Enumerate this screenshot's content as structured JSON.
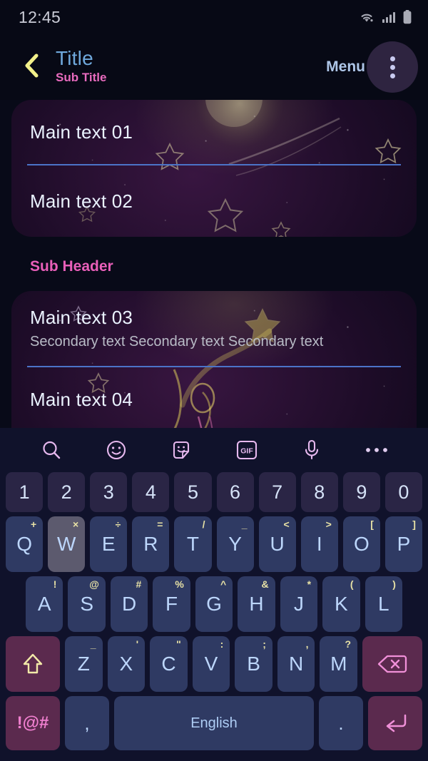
{
  "status_bar": {
    "time": "12:45",
    "icons": [
      "wifi-icon",
      "signal-icon",
      "battery-icon"
    ]
  },
  "app_bar": {
    "back_icon": "chevron-left-icon",
    "title": "Title",
    "subtitle": "Sub Title",
    "menu_label": "Menu",
    "overflow_icon": "more-vertical-icon"
  },
  "content": {
    "card_one": {
      "rows": [
        {
          "main": "Main text 01"
        },
        {
          "main": "Main text 02"
        }
      ]
    },
    "sub_header": "Sub Header",
    "card_two": {
      "rows": [
        {
          "main": "Main text 03",
          "secondary": "Secondary text Secondary text Secondary text"
        },
        {
          "main": "Main text 04"
        }
      ]
    }
  },
  "keyboard": {
    "toolbar": [
      {
        "name": "search-icon",
        "label": "Search"
      },
      {
        "name": "emoji-icon",
        "label": "Emoji"
      },
      {
        "name": "sticker-icon",
        "label": "Sticker"
      },
      {
        "name": "gif-icon",
        "label": "GIF"
      },
      {
        "name": "microphone-icon",
        "label": "Voice input"
      },
      {
        "name": "more-horizontal-icon",
        "label": "More"
      }
    ],
    "number_row": [
      "1",
      "2",
      "3",
      "4",
      "5",
      "6",
      "7",
      "8",
      "9",
      "0"
    ],
    "row_q": [
      {
        "key": "Q",
        "sup": "+"
      },
      {
        "key": "W",
        "sup": "×",
        "pressed": true
      },
      {
        "key": "E",
        "sup": "÷"
      },
      {
        "key": "R",
        "sup": "="
      },
      {
        "key": "T",
        "sup": "/"
      },
      {
        "key": "Y",
        "sup": "_"
      },
      {
        "key": "U",
        "sup": "<"
      },
      {
        "key": "I",
        "sup": ">"
      },
      {
        "key": "O",
        "sup": "["
      },
      {
        "key": "P",
        "sup": "]"
      }
    ],
    "row_a": [
      {
        "key": "A",
        "sup": "!"
      },
      {
        "key": "S",
        "sup": "@"
      },
      {
        "key": "D",
        "sup": "#"
      },
      {
        "key": "F",
        "sup": "%"
      },
      {
        "key": "G",
        "sup": "^"
      },
      {
        "key": "H",
        "sup": "&"
      },
      {
        "key": "J",
        "sup": "*"
      },
      {
        "key": "K",
        "sup": "("
      },
      {
        "key": "L",
        "sup": ")"
      }
    ],
    "row_z": [
      {
        "key": "Z",
        "sup": "_"
      },
      {
        "key": "X",
        "sup": "'"
      },
      {
        "key": "C",
        "sup": "\""
      },
      {
        "key": "V",
        "sup": ":"
      },
      {
        "key": "B",
        "sup": ";"
      },
      {
        "key": "N",
        "sup": ","
      },
      {
        "key": "M",
        "sup": "?"
      }
    ],
    "shift_icon": "shift-arrow-icon",
    "backspace_icon": "backspace-icon",
    "symbols_key": "!@#",
    "comma_key": ",",
    "space_key": "English",
    "period_key": ".",
    "enter_icon": "enter-return-icon"
  },
  "colors": {
    "background": "#080a18",
    "title": "#6fa8dc",
    "subtitle": "#e86bbe",
    "sub_header": "#e95fb9",
    "divider": "#4b73c8",
    "key": "#2f3a63",
    "num_key": "#2a2545",
    "fn_key": "#5b2a4e",
    "accent_pink": "#f07fcf",
    "sup_yellow": "#e8e2a6"
  }
}
